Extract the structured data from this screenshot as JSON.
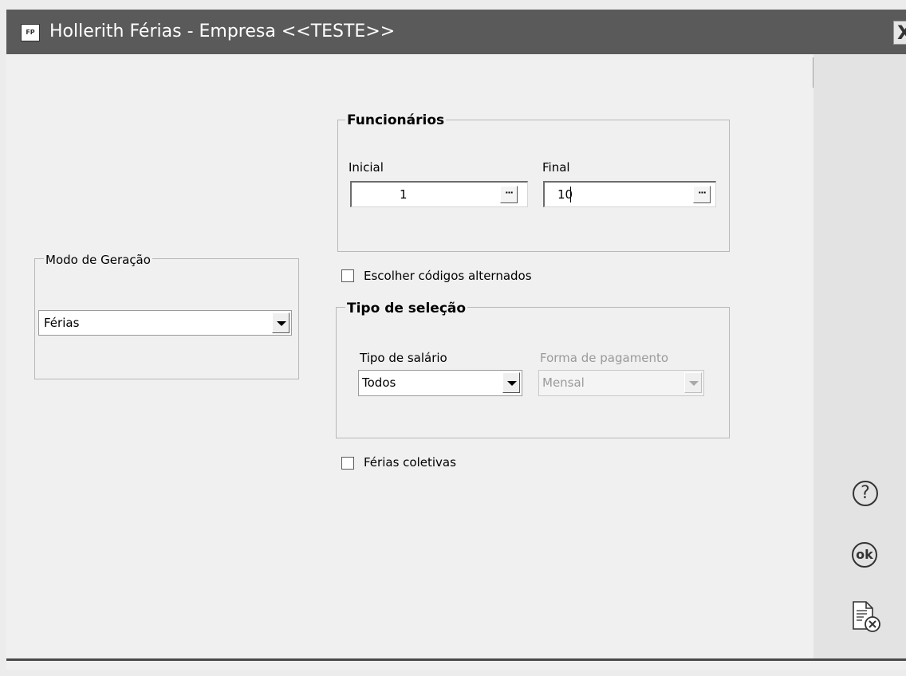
{
  "window": {
    "app_icon_text": "FP",
    "title": "Hollerith Férias - Empresa <<TESTE>>",
    "close_glyph": "X"
  },
  "modo_geracao": {
    "title": "Modo de Geração",
    "selected": "Férias"
  },
  "funcionarios": {
    "title": "Funcionários",
    "inicial_label": "Inicial",
    "inicial_value": "1",
    "final_label": "Final",
    "final_value": "10",
    "lookup_glyph": "···"
  },
  "escolher_codigos": {
    "label": "Escolher códigos alternados",
    "checked": false
  },
  "tipo_selecao": {
    "title": "Tipo de seleção",
    "tipo_salario_label": "Tipo de salário",
    "tipo_salario_value": "Todos",
    "forma_pagamento_label": "Forma de pagamento",
    "forma_pagamento_value": "Mensal"
  },
  "ferias_coletivas": {
    "label": "Férias coletivas",
    "checked": false
  },
  "side_buttons": {
    "help_glyph": "?",
    "ok_glyph": "ok",
    "icons": [
      "help-icon",
      "ok-icon",
      "cancel-document-icon"
    ]
  }
}
